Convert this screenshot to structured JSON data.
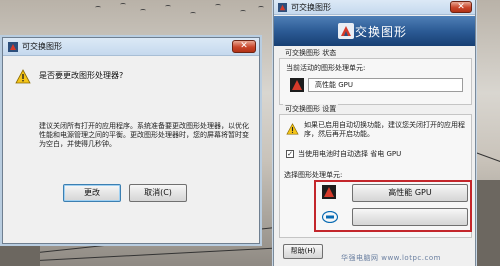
{
  "dialog_confirm": {
    "title": "可交换图形",
    "question": "是否要更改图形处理器?",
    "body": "建议关闭所有打开的应用程序。系统准备要更改图形处理器，以优化性能和电源管理之间的平衡。更改图形处理器时，您的屏幕将暂时变为空白，并使得几秒钟。",
    "change_label": "更改",
    "cancel_label": "取消(C)",
    "close_glyph": "✕"
  },
  "panel": {
    "title": "可交换图形",
    "close_glyph": "✕",
    "banner_title": "可交换图形",
    "status_group": {
      "title": "可交换图形 状态",
      "current_label": "当前活动的图形处理单元:",
      "current_value": "高性能 GPU"
    },
    "settings_group": {
      "title": "可交换图形 设置",
      "info": "如果已启用自动切换功能，建议您关闭打开的应用程序，然后再开启功能。",
      "checkbox_label": "当使用电池时自动选择 省电 GPU",
      "checkbox_checked": true,
      "checkbox_mark": "✓",
      "select_label": "选择图形处理单元:",
      "high_perf_label": "高性能 GPU",
      "power_save_label": ""
    },
    "help_label": "帮助(H)"
  },
  "watermark": "华强电脑网  www.lotpc.com",
  "colors": {
    "highlight_border": "#c3262b",
    "banner": "#2c5b95",
    "close_button": "#c9452a"
  },
  "icons": [
    "warning-icon",
    "amd-icon",
    "intel-icon",
    "processor-icon",
    "app-icon",
    "close-icon"
  ]
}
